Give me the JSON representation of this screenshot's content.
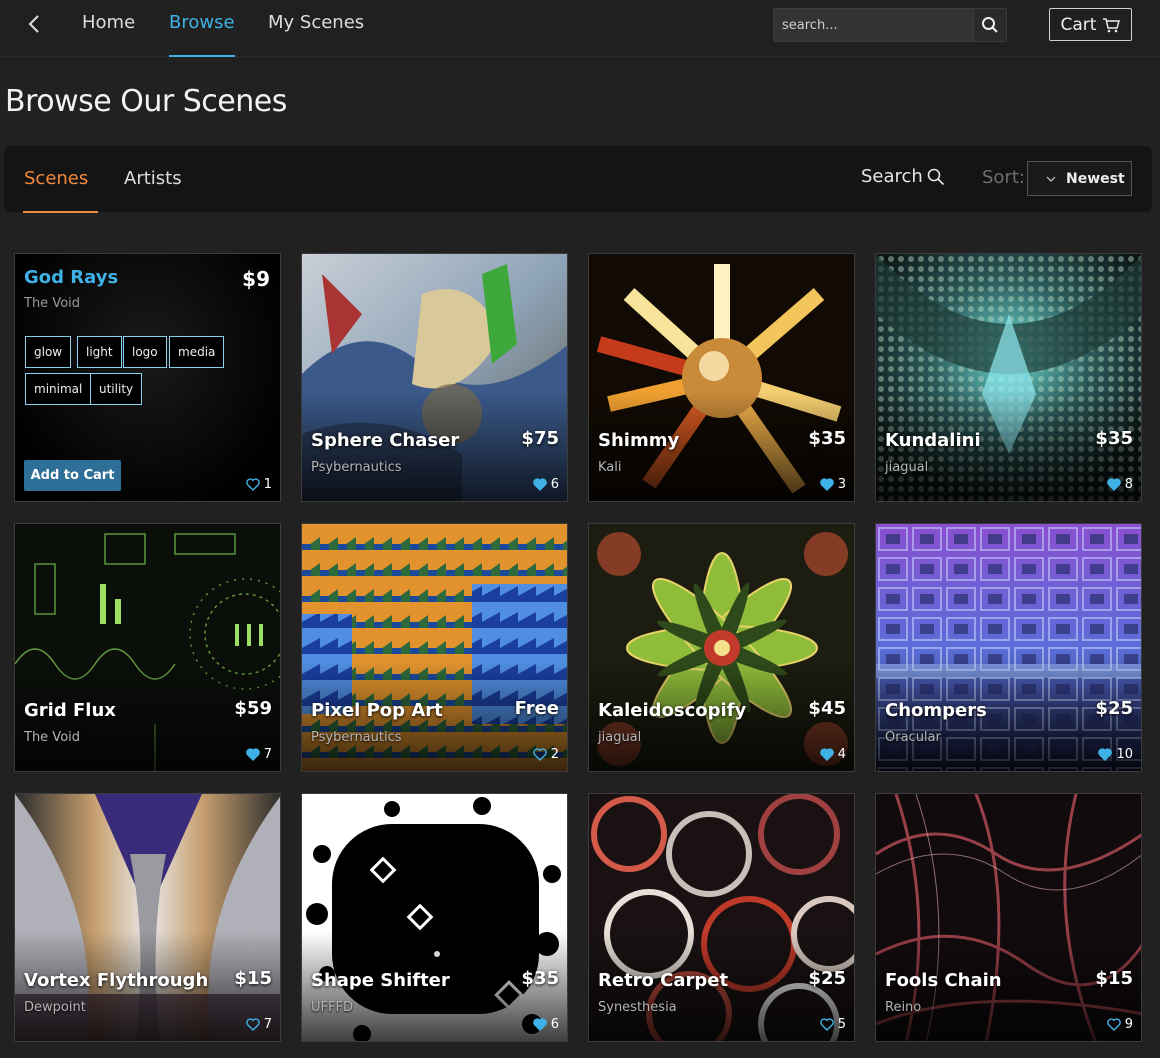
{
  "nav": {
    "links": [
      "Home",
      "Browse",
      "My Scenes"
    ],
    "active": "Browse",
    "search_placeholder": "search...",
    "cart_label": "Cart"
  },
  "page_title": "Browse Our Scenes",
  "filter": {
    "tabs": [
      "Scenes",
      "Artists"
    ],
    "active_tab": "Scenes",
    "search_label": "Search",
    "sort_label": "Sort:",
    "sort_value": "Newest"
  },
  "featured": {
    "title": "God Rays",
    "price": "$9",
    "artist": "The Void",
    "tags": [
      "glow",
      "light",
      "logo",
      "media",
      "minimal",
      "utility"
    ],
    "add_to_cart": "Add to Cart",
    "likes": "1",
    "liked": false
  },
  "scenes": [
    {
      "title": "Sphere Chaser",
      "artist": "Psybernautics",
      "price": "$75",
      "likes": "6",
      "liked": true,
      "art": "chaser"
    },
    {
      "title": "Shimmy",
      "artist": "Kali",
      "price": "$35",
      "likes": "3",
      "liked": true,
      "art": "shimmy"
    },
    {
      "title": "Kundalini",
      "artist": "jiagual",
      "price": "$35",
      "likes": "8",
      "liked": true,
      "art": "kundalini"
    },
    {
      "title": "Grid Flux",
      "artist": "The Void",
      "price": "$59",
      "likes": "7",
      "liked": true,
      "art": "grid"
    },
    {
      "title": "Pixel Pop Art",
      "artist": "Psybernautics",
      "price": "Free",
      "likes": "2",
      "liked": false,
      "art": "pixel"
    },
    {
      "title": "Kaleidoscopify",
      "artist": "jiagual",
      "price": "$45",
      "likes": "4",
      "liked": true,
      "art": "kaleido"
    },
    {
      "title": "Chompers",
      "artist": "Oracular",
      "price": "$25",
      "likes": "10",
      "liked": true,
      "art": "chompers"
    },
    {
      "title": "Vortex Flythrough",
      "artist": "Dewpoint",
      "price": "$15",
      "likes": "7",
      "liked": false,
      "art": "vortex"
    },
    {
      "title": "Shape Shifter",
      "artist": "UFFFD",
      "price": "$35",
      "likes": "6",
      "liked": true,
      "art": "shape"
    },
    {
      "title": "Retro Carpet",
      "artist": "Synesthesia",
      "price": "$25",
      "likes": "5",
      "liked": false,
      "art": "retro"
    },
    {
      "title": "Fools Chain",
      "artist": "Reino",
      "price": "$15",
      "likes": "9",
      "liked": false,
      "art": "fools"
    }
  ],
  "colors": {
    "accent_blue": "#3fb1e6",
    "accent_orange": "#f08a3c",
    "heart_blue": "#3fb1e6",
    "cart_button": "#2e6f97"
  }
}
